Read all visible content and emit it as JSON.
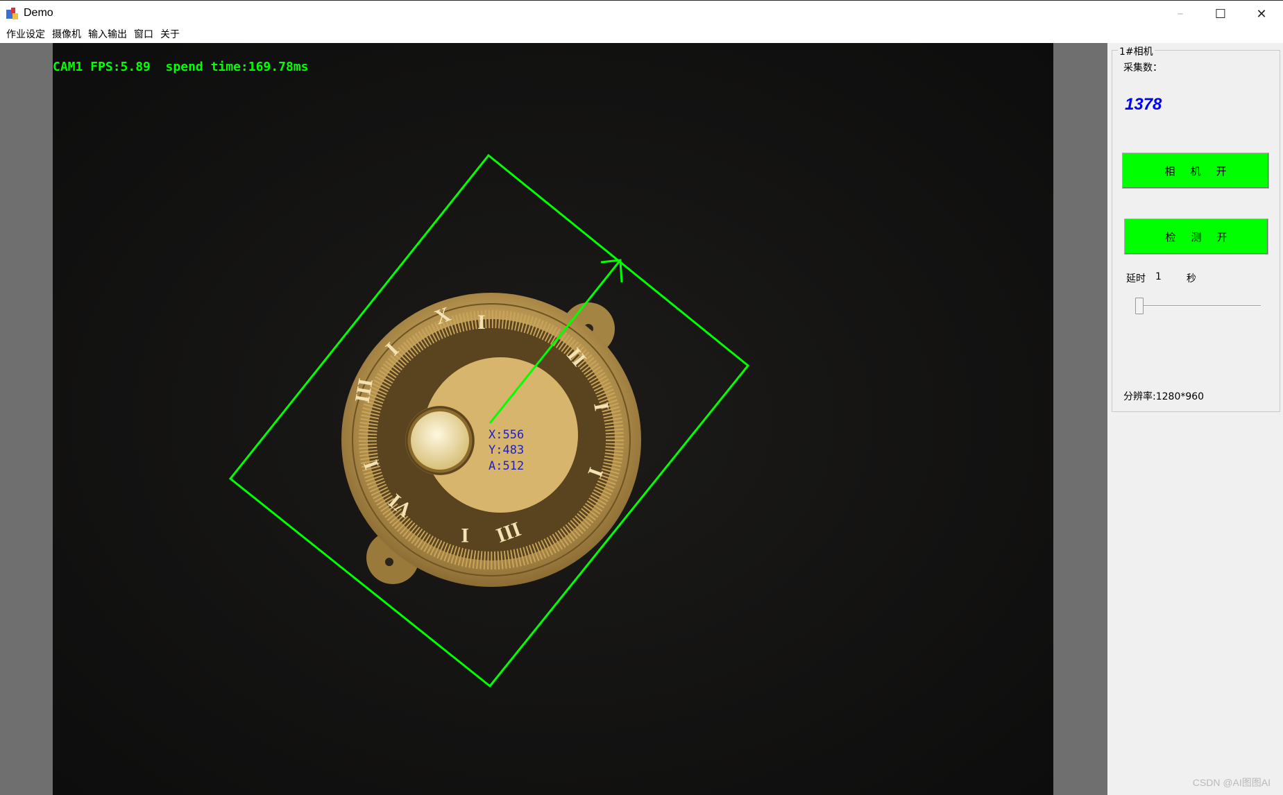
{
  "window": {
    "title": "Demo",
    "app_icon": "demo-app-icon",
    "controls": {
      "minimize": "─",
      "maximize": "☐",
      "close": "✕"
    }
  },
  "menu": {
    "items": [
      "作业设定",
      "摄像机",
      "输入输出",
      "窗口",
      "关于"
    ]
  },
  "camera_view": {
    "overlay_text": "CAM1 FPS:5.89  spend time:169.78ms",
    "overlay_color": "#00ff00",
    "detection": {
      "box_color": "#00ff00",
      "label_color": "#2020c0",
      "x_label": "X:556",
      "y_label": "Y:483",
      "a_label": "A:512"
    }
  },
  "sidebar": {
    "group_title": "1#相机",
    "count_label": "采集数：",
    "count_value": "1378",
    "camera_button": "相机开",
    "detect_button": "检测开",
    "button_color": "#00ff00",
    "delay_label": "延时",
    "delay_value": "1",
    "delay_unit": "秒",
    "delay_slider_fraction": 0.0,
    "resolution": "分辨率:1280*960"
  },
  "watermark": "CSDN @AI图图AI"
}
